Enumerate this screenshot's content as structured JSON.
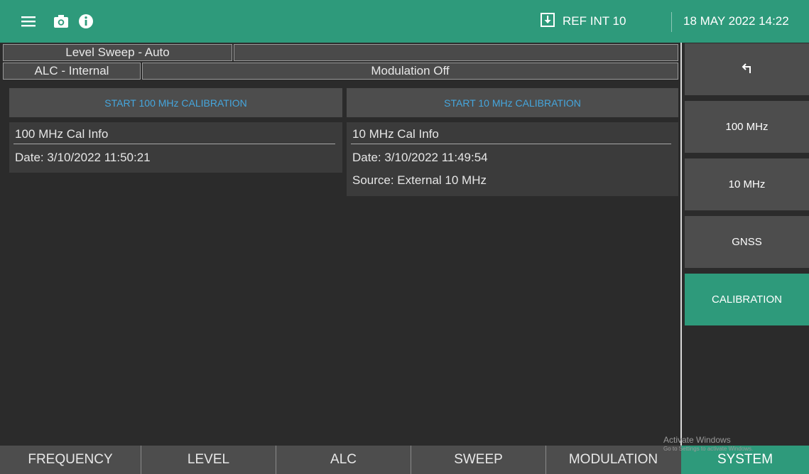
{
  "topbar": {
    "icons": [
      "menu-icon",
      "camera-icon",
      "info-icon",
      "download-icon"
    ],
    "ref_label": "REF INT 10",
    "datetime": "18 MAY 2022 14:22"
  },
  "status": {
    "level_sweep": "Level Sweep - Auto",
    "alc": "ALC - Internal",
    "modulation": "Modulation Off"
  },
  "calibration": {
    "start_100": "START 100 MHz CALIBRATION",
    "start_10": "START 10 MHz CALIBRATION",
    "info_100": {
      "title": "100 MHz Cal Info",
      "date": "Date: 3/10/2022 11:50:21"
    },
    "info_10": {
      "title": "10 MHz Cal Info",
      "date": "Date: 3/10/2022 11:49:54",
      "source": "Source: External 10 MHz"
    }
  },
  "side_menu": {
    "back_icon": "back-arrow-icon",
    "items": [
      "100 MHz",
      "10 MHz",
      "GNSS",
      "CALIBRATION"
    ],
    "active": "CALIBRATION"
  },
  "tabs": {
    "items": [
      "FREQUENCY",
      "LEVEL",
      "ALC",
      "SWEEP",
      "MODULATION",
      "SYSTEM"
    ],
    "active": "SYSTEM"
  },
  "watermark": {
    "line1": "Activate Windows",
    "line2": "Go to Settings to activate Windows."
  },
  "colors": {
    "accent": "#2e9a7b",
    "background": "#2b2b2b",
    "button": "#4d4d4d",
    "link_text": "#45a6dd"
  }
}
